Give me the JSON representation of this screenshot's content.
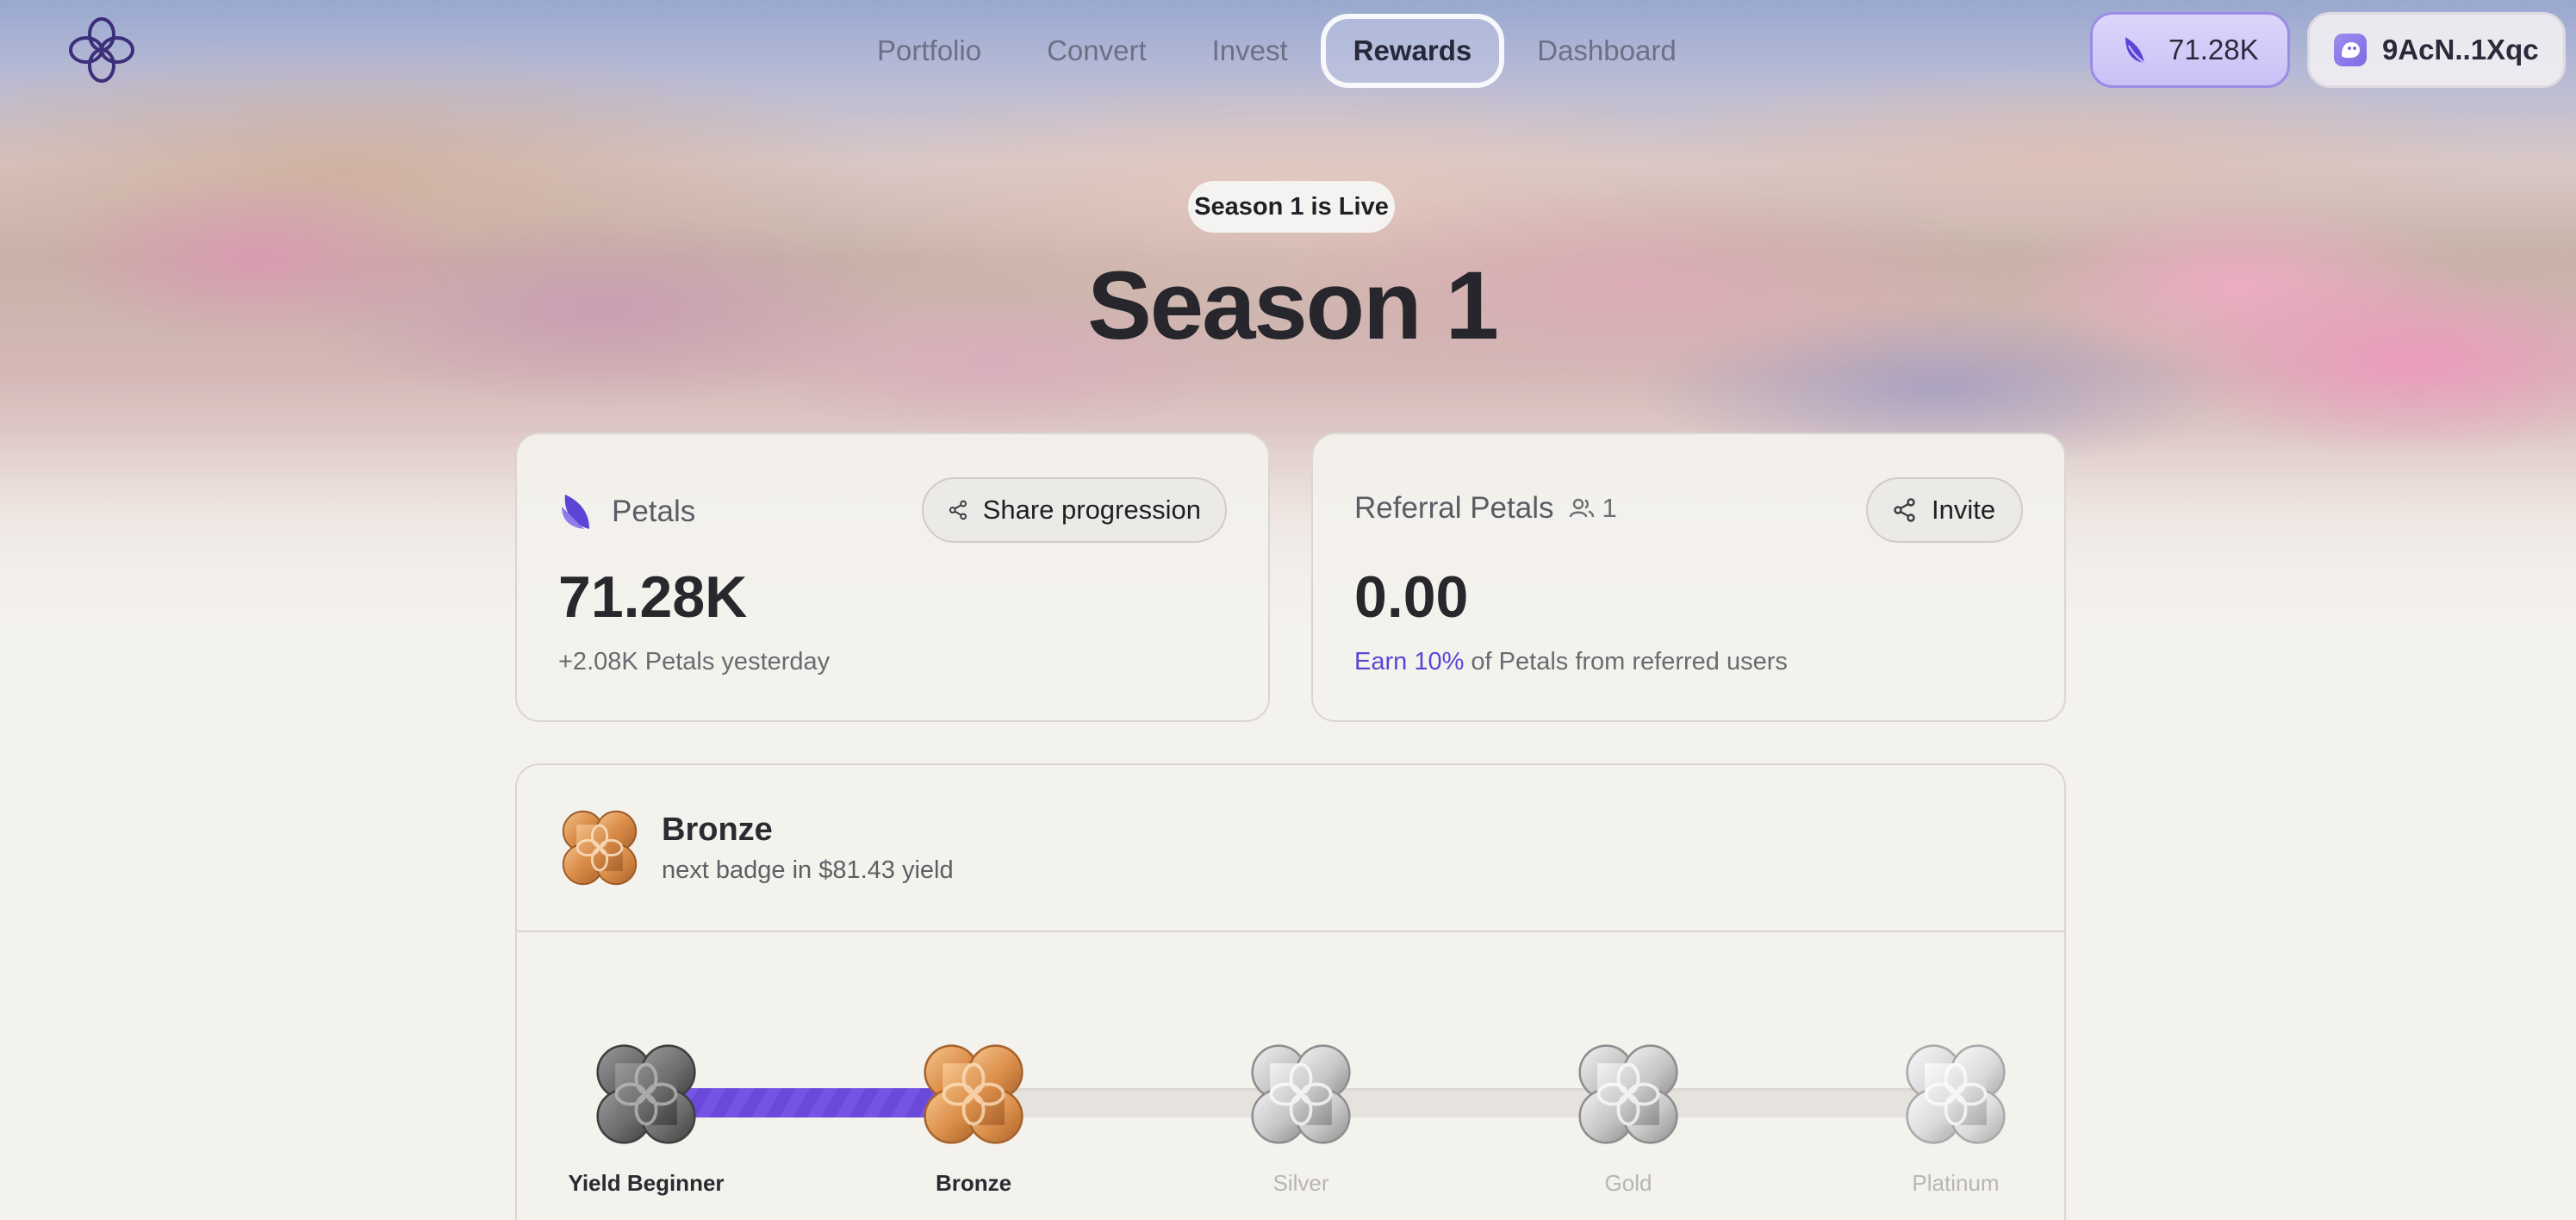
{
  "nav": {
    "items": [
      {
        "label": "Portfolio",
        "active": false
      },
      {
        "label": "Convert",
        "active": false
      },
      {
        "label": "Invest",
        "active": false
      },
      {
        "label": "Rewards",
        "active": true
      },
      {
        "label": "Dashboard",
        "active": false
      }
    ],
    "petals_balance": "71.28K",
    "wallet_address": "9AcN..1Xqc"
  },
  "season": {
    "badge": "Season 1 is Live",
    "title": "Season 1"
  },
  "petals_card": {
    "label": "Petals",
    "share_label": "Share progression",
    "value": "71.28K",
    "yesterday": "+2.08K Petals yesterday"
  },
  "referral_card": {
    "label": "Referral Petals",
    "referral_count": "1",
    "invite_label": "Invite",
    "value": "0.00",
    "earn_accent": "Earn 10%",
    "earn_rest": " of Petals from referred users"
  },
  "badge_card": {
    "current_badge": "Bronze",
    "next_badge": "next badge in $81.43 yield",
    "progress_fraction": 0.25,
    "tiers": [
      {
        "label": "Yield Beginner",
        "status": "done",
        "medal": "gray"
      },
      {
        "label": "Bronze",
        "status": "current",
        "medal": "bronze"
      },
      {
        "label": "Silver",
        "status": "locked",
        "medal": "silver"
      },
      {
        "label": "Gold",
        "status": "locked",
        "medal": "silver"
      },
      {
        "label": "Platinum",
        "status": "locked",
        "medal": "light"
      }
    ]
  },
  "colors": {
    "accent": "#5b45d6",
    "bronze": "#d98c48",
    "progress": "#7454e2"
  }
}
